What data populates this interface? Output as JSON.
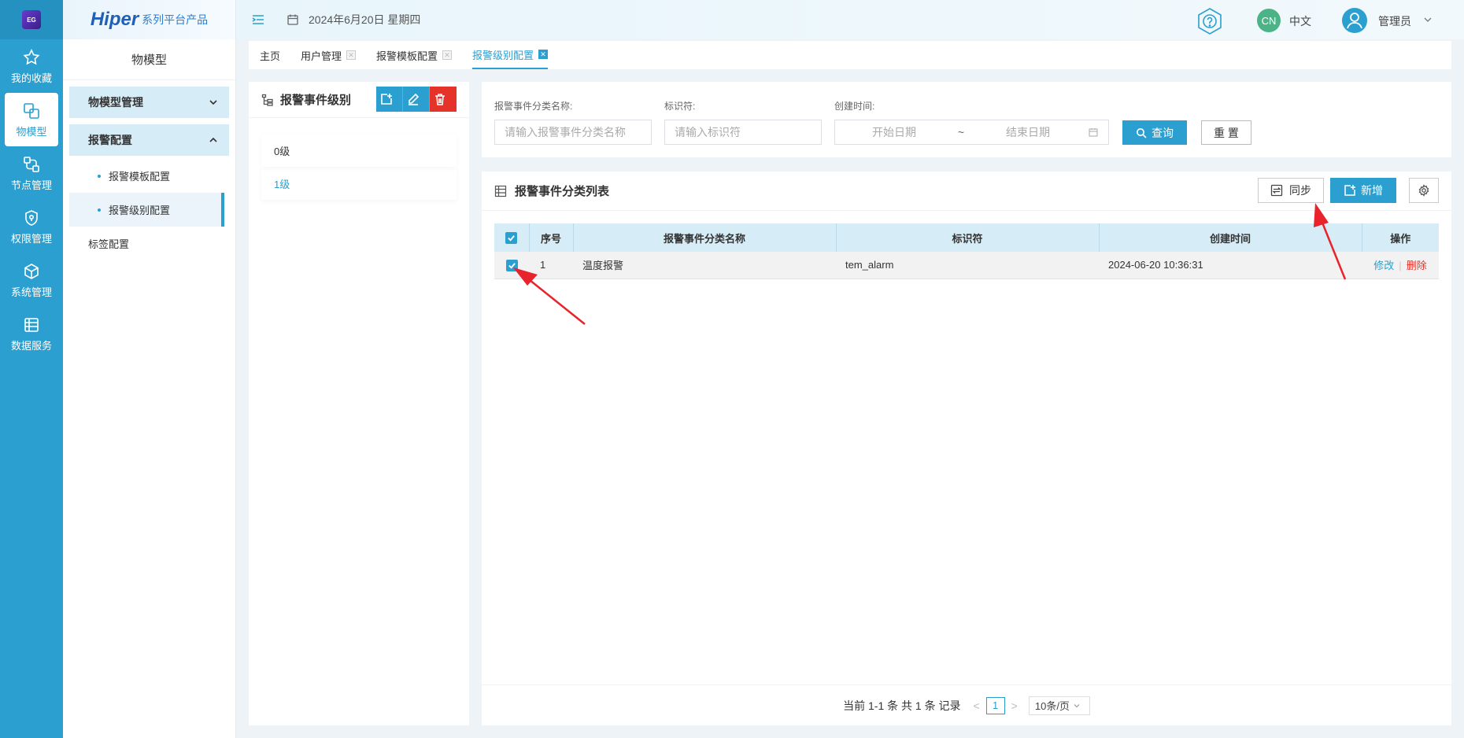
{
  "rail": {
    "logo": "EG",
    "items": [
      {
        "label": "我的收藏",
        "icon": "star-icon"
      },
      {
        "label": "物模型",
        "icon": "model-icon"
      },
      {
        "label": "节点管理",
        "icon": "node-icon"
      },
      {
        "label": "权限管理",
        "icon": "shield-icon"
      },
      {
        "label": "系统管理",
        "icon": "cube-icon"
      },
      {
        "label": "数据服务",
        "icon": "data-icon"
      }
    ]
  },
  "sidebar": {
    "brand_main": "Hiper",
    "brand_sub": "系列平台产品",
    "title": "物模型",
    "group1": "物模型管理",
    "group2": "报警配置",
    "sub1": "报警模板配置",
    "sub2": "报警级别配置",
    "plain": "标签配置"
  },
  "header": {
    "date": "2024年6月20日 星期四",
    "lang_badge": "CN",
    "lang": "中文",
    "user": "管理员"
  },
  "tabs": [
    "主页",
    "用户管理",
    "报警模板配置",
    "报警级别配置"
  ],
  "level_panel": {
    "title": "报警事件级别",
    "levels": [
      "0级",
      "1级"
    ]
  },
  "filter": {
    "name_label": "报警事件分类名称:",
    "name_placeholder": "请输入报警事件分类名称",
    "code_label": "标识符:",
    "code_placeholder": "请输入标识符",
    "time_label": "创建时间:",
    "start_placeholder": "开始日期",
    "range_sep": "~",
    "end_placeholder": "结束日期",
    "query": "查询",
    "reset": "重 置"
  },
  "list": {
    "title": "报警事件分类列表",
    "sync": "同步",
    "add": "新增",
    "columns": [
      "序号",
      "报警事件分类名称",
      "标识符",
      "创建时间",
      "操作"
    ],
    "rows": [
      {
        "index": "1",
        "name": "温度报警",
        "code": "tem_alarm",
        "created": "2024-06-20 10:36:31"
      }
    ],
    "edit": "修改",
    "delete": "删除"
  },
  "pager": {
    "summary": "当前 1-1 条 共 1 条 记录",
    "page": "1",
    "size": "10条/页"
  },
  "colors": {
    "primary": "#2a9fd0",
    "danger": "#e5332a",
    "annotation": "#e8232b"
  }
}
